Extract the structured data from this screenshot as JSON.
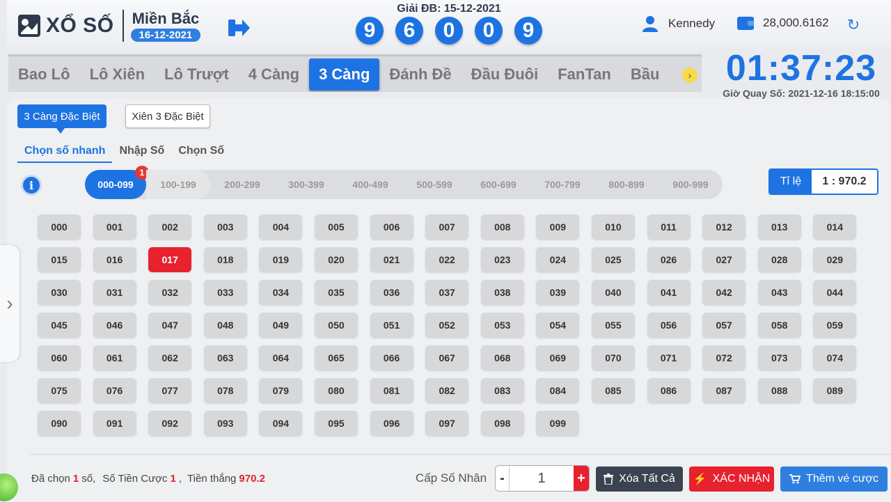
{
  "header": {
    "logo_text": "XỔ SỐ",
    "region_name": "Miền Bắc",
    "region_date": "16-12-2021",
    "result_title": "Giải ĐB: 15-12-2021",
    "result_digits": [
      "9",
      "6",
      "0",
      "0",
      "9"
    ],
    "username": "Kennedy",
    "balance": "28,000.6162"
  },
  "tabs": [
    "Bao Lô",
    "Lô Xiên",
    "Lô Trượt",
    "4 Càng",
    "3 Càng",
    "Đánh Đề",
    "Đầu Đuôi",
    "FanTan",
    "Bầu"
  ],
  "active_tab": "3 Càng",
  "clock": {
    "time": "01:37:23",
    "draw_time": "Giờ Quay Số: 2021-12-16 18:15:00"
  },
  "sub_types": [
    "3 Càng Đặc Biệt",
    "Xiên 3 Đặc Biệt"
  ],
  "modes": [
    "Chọn số nhanh",
    "Nhập Số",
    "Chọn Số"
  ],
  "info_label": "i",
  "ranges": [
    "000-099",
    "100-199",
    "200-299",
    "300-399",
    "400-499",
    "500-599",
    "600-699",
    "700-799",
    "800-899",
    "900-999"
  ],
  "range_badge": "1",
  "rate": {
    "label": "Tỉ lệ",
    "value": "1 : 970.2"
  },
  "numbers": [
    "000",
    "001",
    "002",
    "003",
    "004",
    "005",
    "006",
    "007",
    "008",
    "009",
    "010",
    "011",
    "012",
    "013",
    "014",
    "015",
    "016",
    "017",
    "018",
    "019",
    "020",
    "021",
    "022",
    "023",
    "024",
    "025",
    "026",
    "027",
    "028",
    "029",
    "030",
    "031",
    "032",
    "033",
    "034",
    "035",
    "036",
    "037",
    "038",
    "039",
    "040",
    "041",
    "042",
    "043",
    "044",
    "045",
    "046",
    "047",
    "048",
    "049",
    "050",
    "051",
    "052",
    "053",
    "054",
    "055",
    "056",
    "057",
    "058",
    "059",
    "060",
    "061",
    "062",
    "063",
    "064",
    "065",
    "066",
    "067",
    "068",
    "069",
    "070",
    "071",
    "072",
    "073",
    "074",
    "075",
    "076",
    "077",
    "078",
    "079",
    "080",
    "081",
    "082",
    "083",
    "084",
    "085",
    "086",
    "087",
    "088",
    "089",
    "090",
    "091",
    "092",
    "093",
    "094",
    "095",
    "096",
    "097",
    "098",
    "099"
  ],
  "selected_number": "017",
  "summary": {
    "chosen_prefix": "Đã chọn",
    "chosen_count": "1",
    "chosen_suffix": "số,",
    "bet_label": "Số Tiền Cược",
    "bet_amount": "1",
    "win_label": ",  Tiền thắng",
    "win_amount": "970.2"
  },
  "multiplier": {
    "label": "Cấp Số Nhân",
    "value": "1",
    "minus": "-",
    "plus": "+"
  },
  "buttons": {
    "clear": "Xóa Tất Cả",
    "confirm": "XÁC NHẬN",
    "add": "Thêm vé cược"
  },
  "colors": {
    "primary": "#1e73e2",
    "danger": "#e8212e",
    "dark": "#3c4350"
  }
}
